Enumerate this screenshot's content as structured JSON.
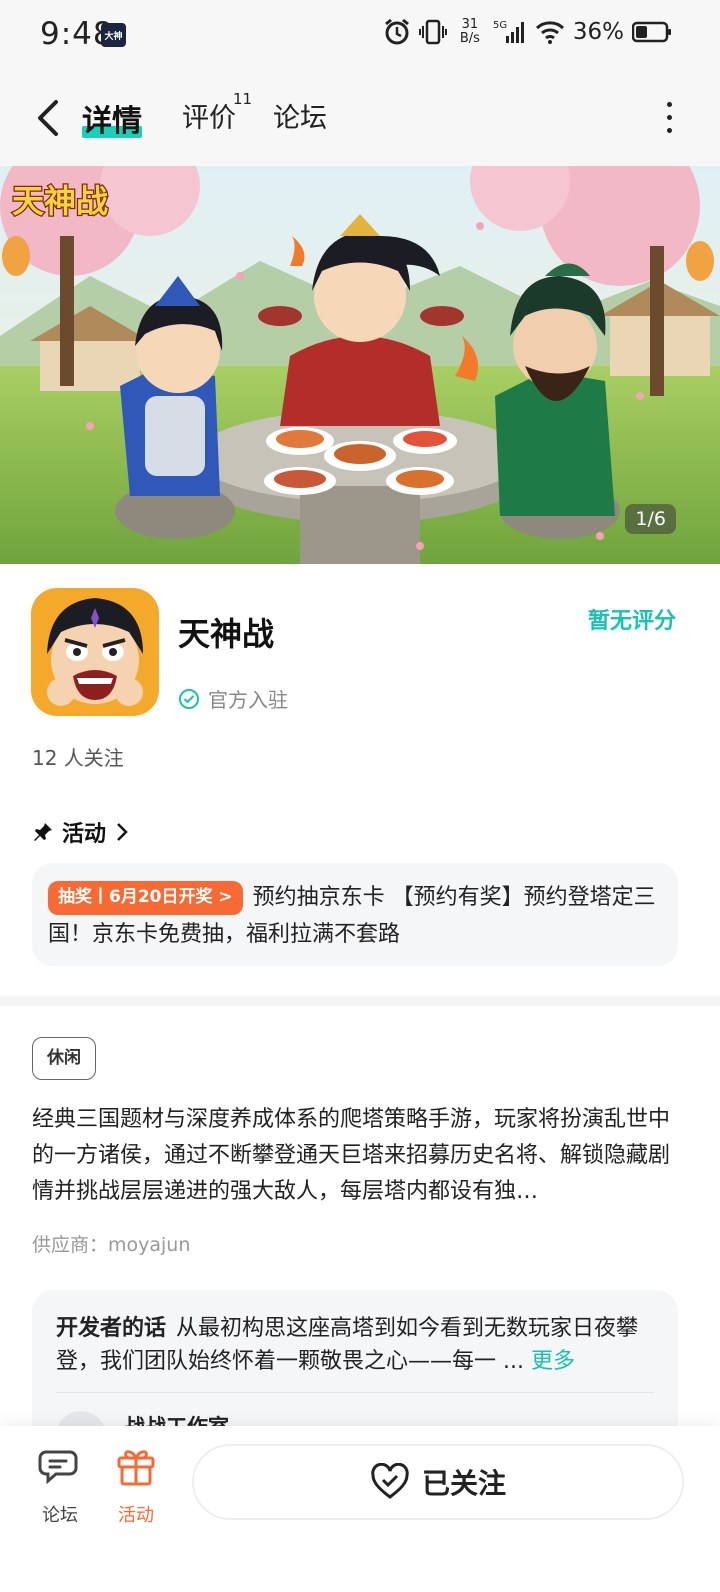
{
  "status_bar": {
    "time": "9:48",
    "badge": "大神",
    "net_speed_value": "31",
    "net_speed_unit": "B/s",
    "battery": "36%",
    "icons": [
      "alarm-icon",
      "vibrate-icon",
      "signal-5g-icon",
      "wifi-icon",
      "battery-icon"
    ]
  },
  "nav": {
    "tabs": [
      {
        "label": "详情",
        "active": true
      },
      {
        "label": "评价",
        "count": "11"
      },
      {
        "label": "论坛"
      }
    ]
  },
  "banner": {
    "logo_text": "天神战",
    "counter": "1/6"
  },
  "app": {
    "name": "天神战",
    "official": "官方入驻",
    "rating": "暂无评分",
    "followers": "12 人关注"
  },
  "activity": {
    "heading": "活动",
    "tag": "抽奖丨6月20日开奖 >",
    "text": "预约抽京东卡 【预约有奖】预约登塔定三国！京东卡免费抽，福利拉满不套路"
  },
  "genre": "休闲",
  "description": "经典三国题材与深度养成体系的爬塔策略手游，玩家将扮演乱世中的一方诸侯，通过不断攀登通天巨塔来招募历史名将、解锁隐藏剧情并挑战层层递进的强大敌人，每层塔内都设有独…",
  "supplier": "供应商：moyajun",
  "developer": {
    "title": "开发者的话",
    "text": "从最初构思这座高塔到如今看到无数玩家日夜攀登，我们团队始终怀着一颗敬畏之心——每一 ...",
    "more": "更多",
    "studio": "战战工作室"
  },
  "bottom_bar": {
    "forum": "论坛",
    "activity": "活动",
    "follow": "已关注"
  },
  "colors": {
    "accent": "#19c2ae",
    "orange": "#f76a33"
  }
}
